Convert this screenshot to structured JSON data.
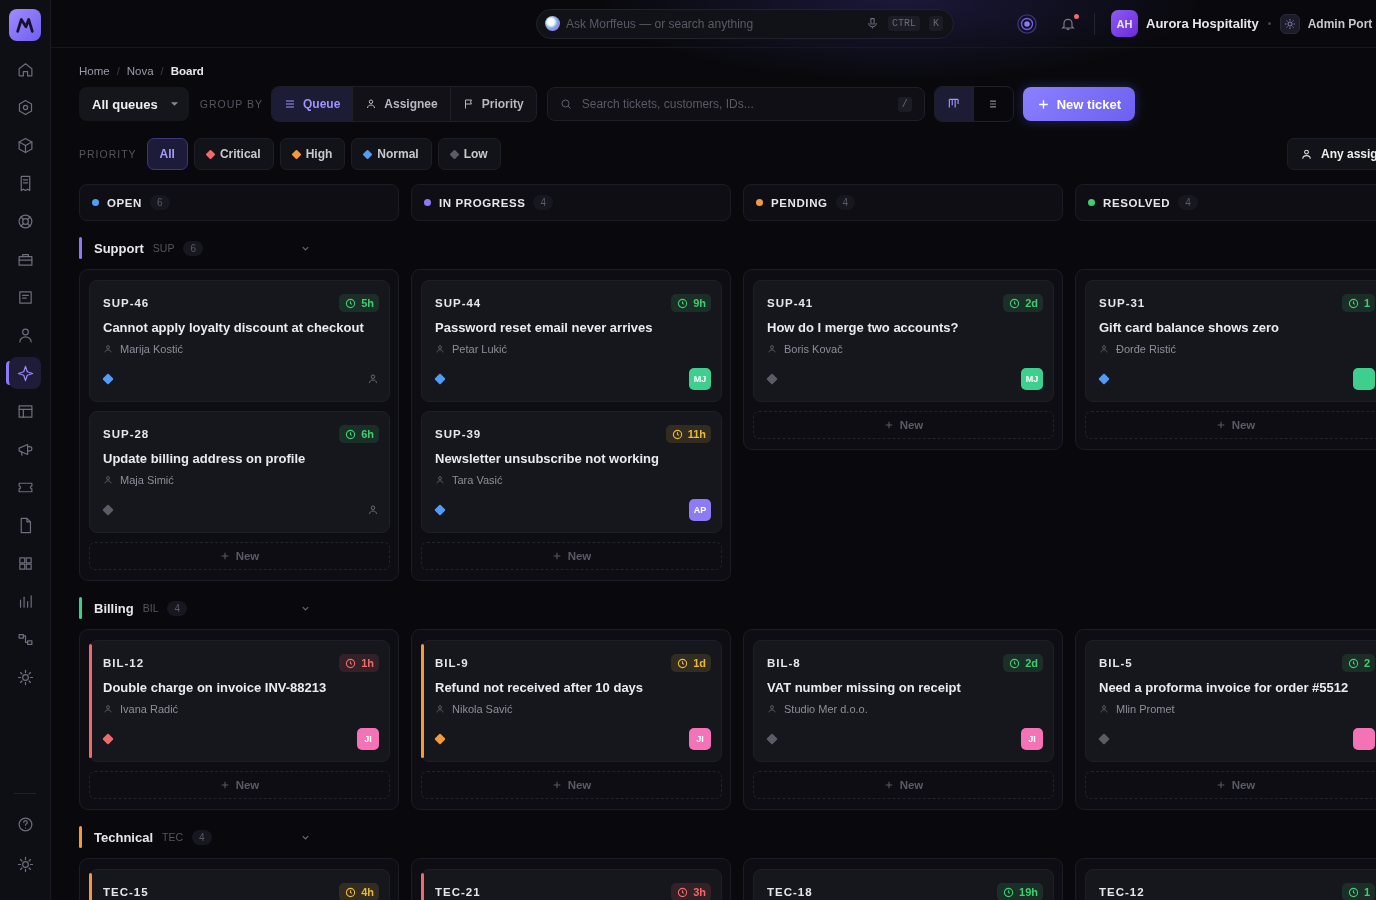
{
  "sidebar": {
    "items": [
      {
        "selected": false
      },
      {
        "selected": false
      },
      {
        "selected": false
      },
      {
        "selected": false
      },
      {
        "selected": false
      },
      {
        "selected": false
      },
      {
        "selected": false
      },
      {
        "selected": false
      },
      {
        "selected": true
      },
      {
        "selected": false
      },
      {
        "selected": false
      },
      {
        "selected": false
      },
      {
        "selected": false
      },
      {
        "selected": false
      },
      {
        "selected": false
      },
      {
        "selected": false
      },
      {
        "selected": false
      }
    ],
    "bottom_items": [
      {
        "selected": false
      },
      {
        "selected": false
      }
    ]
  },
  "topbar": {
    "ask": {
      "placeholder": "Ask Morffeus — or search anything"
    },
    "keys": [
      "CTRL",
      "K"
    ],
    "notifications_unread": true,
    "account": {
      "initials": "AH",
      "name": "Aurora Hospitality"
    },
    "portal": "Admin Port"
  },
  "breadcrumb": [
    {
      "label": "Home",
      "current": false
    },
    {
      "separator": "/",
      "label": "Nova",
      "current": false
    },
    {
      "separator": "/",
      "label": "Board",
      "current": true
    }
  ],
  "toolbar": {
    "queue_select": "All queues",
    "group_by_label": "GROUP BY",
    "group_by": [
      {
        "label": "Queue",
        "selected": true
      },
      {
        "label": "Assignee",
        "selected": false
      },
      {
        "label": "Priority",
        "selected": false
      }
    ],
    "search": {
      "placeholder": "Search tickets, customers, IDs...",
      "shortcut": "/"
    },
    "views": [
      {
        "selected": true
      },
      {
        "selected": false
      }
    ],
    "new_ticket": "New ticket"
  },
  "priority_filter": {
    "label": "PRIORITY",
    "options": [
      {
        "label": "All",
        "selected": true
      },
      {
        "label": "Critical",
        "selected": false,
        "color": "#f06a6a"
      },
      {
        "label": "High",
        "selected": false,
        "color": "#f59a3c"
      },
      {
        "label": "Normal",
        "selected": false,
        "color": "#4f9cf9"
      },
      {
        "label": "Low",
        "selected": false,
        "color": "#5c5c66"
      }
    ],
    "assignee": "Any assig"
  },
  "columns": [
    {
      "label": "OPEN",
      "count": "6",
      "color": "#4f9cf9"
    },
    {
      "label": "IN PROGRESS",
      "count": "4",
      "color": "#8b7cf6"
    },
    {
      "label": "PENDING",
      "count": "4",
      "color": "#f59a3c"
    },
    {
      "label": "RESOLVED",
      "count": "4",
      "color": "#3ecf6e"
    }
  ],
  "groups": [
    {
      "name": "Support",
      "code": "SUP",
      "count": "6",
      "color": "#8b7cf6",
      "cells": [
        {
          "cards": [
            {
              "id": "SUP-46",
              "sla": {
                "time": "5h",
                "color": "#3ecf6e"
              },
              "title": "Cannot apply loyalty discount at checkout",
              "customer": "Marija Kostić",
              "priority": {
                "color": "#4f9cf9"
              },
              "flagged": false
            },
            {
              "id": "SUP-28",
              "sla": {
                "time": "6h",
                "color": "#3ecf6e"
              },
              "title": "Update billing address on profile",
              "customer": "Maja Simić",
              "priority": {
                "color": "#5c5c66"
              },
              "flagged": false
            }
          ],
          "new_label": "New"
        },
        {
          "cards": [
            {
              "id": "SUP-44",
              "sla": {
                "time": "9h",
                "color": "#3ecf6e"
              },
              "title": "Password reset email never arrives",
              "customer": "Petar Lukić",
              "priority": {
                "color": "#4f9cf9"
              },
              "flagged": false,
              "assignee": {
                "initials": "MJ",
                "color": "#3ecf8e"
              }
            },
            {
              "id": "SUP-39",
              "sla": {
                "time": "11h",
                "color": "#e8b93a"
              },
              "title": "Newsletter unsubscribe not working",
              "customer": "Tara Vasić",
              "priority": {
                "color": "#4f9cf9"
              },
              "flagged": false,
              "assignee": {
                "initials": "AP",
                "color": "#8b7cf6"
              }
            }
          ],
          "new_label": "New"
        },
        {
          "cards": [
            {
              "id": "SUP-41",
              "sla": {
                "time": "2d",
                "color": "#3ecf6e"
              },
              "title": "How do I merge two accounts?",
              "customer": "Boris Kovač",
              "priority": {
                "color": "#5c5c66"
              },
              "flagged": false,
              "assignee": {
                "initials": "MJ",
                "color": "#3ecf8e"
              }
            }
          ],
          "new_label": "New"
        },
        {
          "cards": [
            {
              "id": "SUP-31",
              "sla": {
                "time": "1",
                "color": "#3ecf6e"
              },
              "title": "Gift card balance shows zero",
              "customer": "Đorđe Ristić",
              "priority": {
                "color": "#4f9cf9"
              },
              "flagged": false,
              "assignee": {
                "color": "#3ecf8e"
              }
            }
          ],
          "new_label": "New"
        }
      ]
    },
    {
      "name": "Billing",
      "code": "BIL",
      "count": "4",
      "color": "#3ecf8e",
      "cells": [
        {
          "cards": [
            {
              "id": "BIL-12",
              "sla": {
                "time": "1h",
                "color": "#f06a6a"
              },
              "title": "Double charge on invoice INV-88213",
              "customer": "Ivana Radić",
              "priority": {
                "color": "#f06a6a"
              },
              "flagged": true,
              "assignee": {
                "initials": "JI",
                "color": "#f472b6"
              }
            }
          ],
          "new_label": "New"
        },
        {
          "cards": [
            {
              "id": "BIL-9",
              "sla": {
                "time": "1d",
                "color": "#e8b93a"
              },
              "title": "Refund not received after 10 days",
              "customer": "Nikola Savić",
              "priority": {
                "color": "#f59a3c"
              },
              "flagged": true,
              "assignee": {
                "initials": "JI",
                "color": "#f472b6"
              }
            }
          ],
          "new_label": "New"
        },
        {
          "cards": [
            {
              "id": "BIL-8",
              "sla": {
                "time": "2d",
                "color": "#3ecf6e"
              },
              "title": "VAT number missing on receipt",
              "customer": "Studio Mer d.o.o.",
              "priority": {
                "color": "#5c5c66"
              },
              "flagged": false,
              "assignee": {
                "initials": "JI",
                "color": "#f472b6"
              }
            }
          ],
          "new_label": "New"
        },
        {
          "cards": [
            {
              "id": "BIL-5",
              "sla": {
                "time": "2",
                "color": "#3ecf6e"
              },
              "title": "Need a proforma invoice for order #5512",
              "customer": "Mlin Promet",
              "priority": {
                "color": "#5c5c66"
              },
              "flagged": false,
              "assignee": {
                "color": "#f472b6"
              }
            }
          ],
          "new_label": "New"
        }
      ]
    },
    {
      "name": "Technical",
      "code": "TEC",
      "count": "4",
      "color": "#f59a3c",
      "cells": [
        {
          "cards": [
            {
              "id": "TEC-15",
              "sla": {
                "time": "4h",
                "color": "#e8b93a"
              },
              "flagged": true,
              "priority": {
                "color": "#f59a3c"
              }
            }
          ]
        },
        {
          "cards": [
            {
              "id": "TEC-21",
              "sla": {
                "time": "3h",
                "color": "#f06a6a"
              },
              "flagged": true,
              "priority": {
                "color": "#f06a6a"
              }
            }
          ]
        },
        {
          "cards": [
            {
              "id": "TEC-18",
              "sla": {
                "time": "19h",
                "color": "#3ecf6e"
              }
            }
          ]
        },
        {
          "cards": [
            {
              "id": "TEC-12",
              "sla": {
                "time": "1",
                "color": "#3ecf6e"
              }
            }
          ]
        }
      ]
    }
  ]
}
